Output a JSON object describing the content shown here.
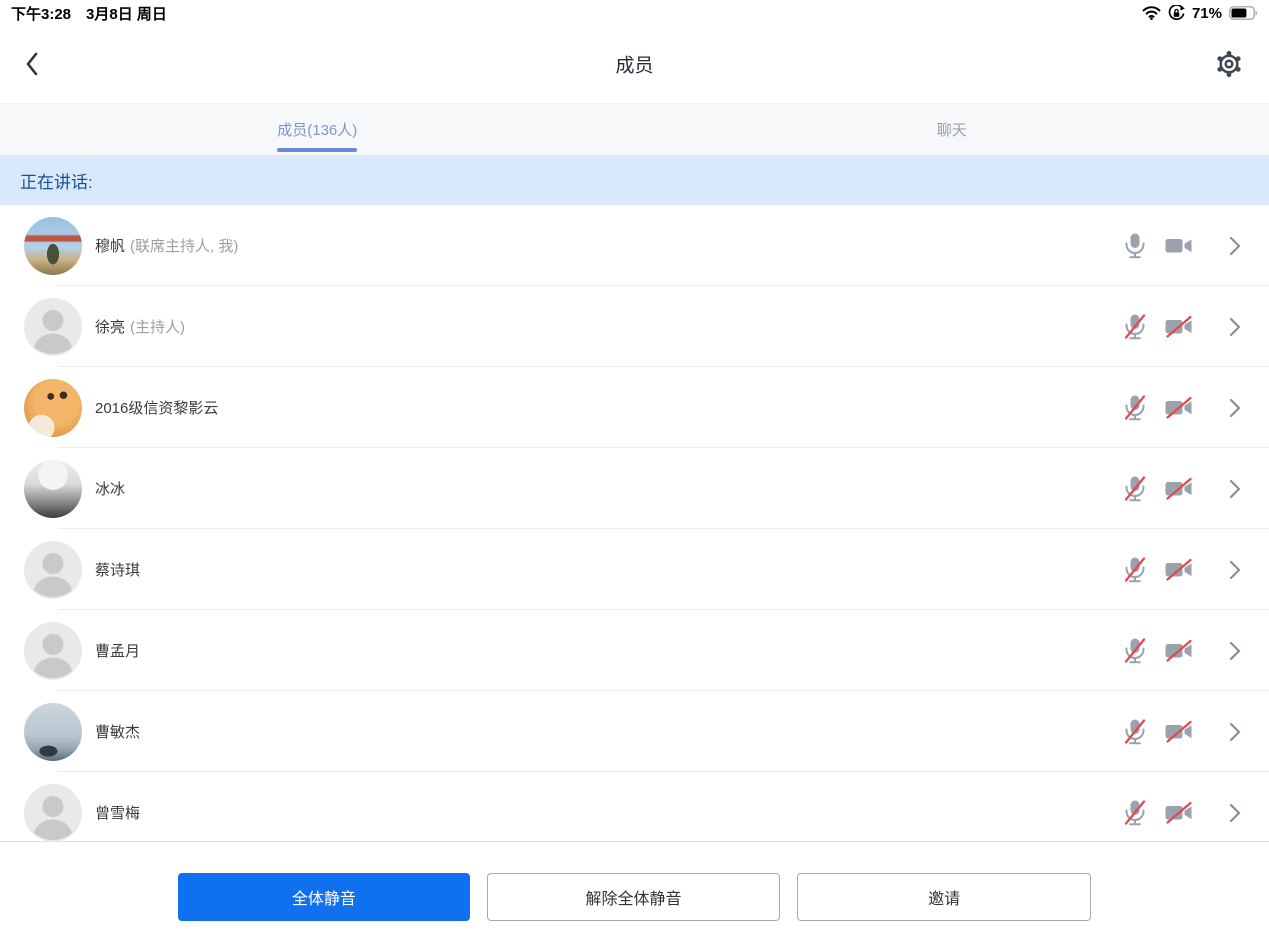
{
  "status_bar": {
    "time": "下午3:28",
    "date": "3月8日 周日",
    "battery_percent": "71%",
    "icons": [
      "wifi-icon",
      "orientation-lock-icon",
      "battery-icon"
    ]
  },
  "header": {
    "title": "成员",
    "back_icon": "chevron-left",
    "settings_icon": "gear"
  },
  "tabs": [
    {
      "label": "成员(136人)",
      "active": true
    },
    {
      "label": "聊天",
      "active": false
    }
  ],
  "speaking_banner": {
    "text": "正在讲话:"
  },
  "members": [
    {
      "name": "穆帆",
      "role": "(联席主持人, 我)",
      "avatar": "photo-bridge",
      "mic_muted": false,
      "camera_off": false
    },
    {
      "name": "徐亮",
      "role": "(主持人)",
      "avatar": "default",
      "mic_muted": true,
      "camera_off": true
    },
    {
      "name": "2016级信资黎影云",
      "role": "",
      "avatar": "photo-cat",
      "mic_muted": true,
      "camera_off": true
    },
    {
      "name": "冰冰",
      "role": "",
      "avatar": "photo-anime",
      "mic_muted": true,
      "camera_off": true
    },
    {
      "name": "蔡诗琪",
      "role": "",
      "avatar": "default",
      "mic_muted": true,
      "camera_off": true
    },
    {
      "name": "曹孟月",
      "role": "",
      "avatar": "default",
      "mic_muted": true,
      "camera_off": true
    },
    {
      "name": "曹敏杰",
      "role": "",
      "avatar": "photo-mountain",
      "mic_muted": true,
      "camera_off": true
    },
    {
      "name": "曾雪梅",
      "role": "",
      "avatar": "default",
      "mic_muted": true,
      "camera_off": true
    }
  ],
  "footer": {
    "buttons": [
      {
        "label": "全体静音",
        "style": "primary"
      },
      {
        "label": "解除全体静音",
        "style": "outline"
      },
      {
        "label": "邀请",
        "style": "outline"
      }
    ]
  },
  "colors": {
    "primary_blue": "#0f70f0",
    "banner_bg": "#d9e8fb",
    "banner_text": "#17509f",
    "tab_active_text": "#7e95ce",
    "tab_underline": "#6d89d3",
    "muted_slash_red": "#e14b4b",
    "icon_gray": "#9aa2ad"
  }
}
